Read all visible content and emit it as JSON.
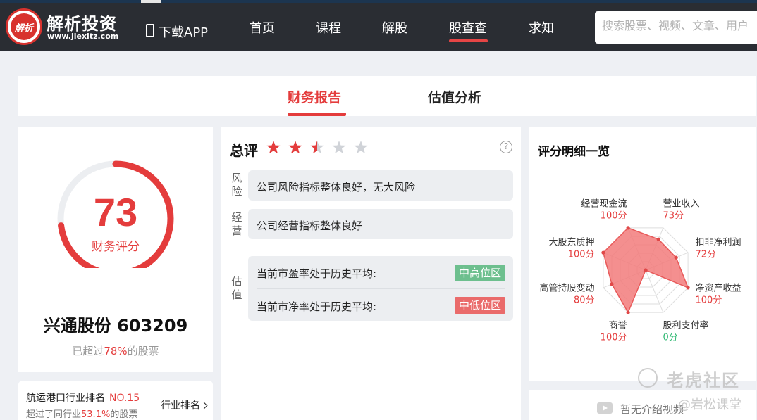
{
  "header": {
    "logo_badge": "解析",
    "logo_title": "解析投资",
    "logo_domain": "www.jiexitz.com",
    "app_download": "下载APP",
    "nav": [
      "首页",
      "课程",
      "解股",
      "股查查",
      "求知"
    ],
    "active_nav": "股查查",
    "search_placeholder": "搜索股票、视频、文章、用户"
  },
  "tabs": {
    "items": [
      "财务报告",
      "估值分析"
    ],
    "active": "财务报告"
  },
  "score": {
    "value": "73",
    "value_fraction": 0.73,
    "label": "财务评分",
    "stock": "兴通股份 603209",
    "beat_prefix": "已超过",
    "beat_pct": "78%",
    "beat_suffix": "的股票"
  },
  "rank": {
    "industry": "航运港口行业排名",
    "rank": "NO.15",
    "beat_prefix": "超过了同行业",
    "beat_pct": "53.1%",
    "beat_suffix": "的股票",
    "link": "行业排名"
  },
  "overall": {
    "title": "总评",
    "stars": 2.5,
    "stars_max": 5,
    "help": "?",
    "risk_label": "风险",
    "risk_text": "公司风险指标整体良好，无大风险",
    "ops_label": "经营",
    "ops_text": "公司经营指标整体良好",
    "valuation_label": "估值",
    "pe_text": "当前市盈率处于历史平均:",
    "pe_badge": "中高位区",
    "pb_text": "当前市净率处于历史平均:",
    "pb_badge": "中低位区"
  },
  "radar": {
    "title": "评分明细一览",
    "items": [
      {
        "name": "营业收入",
        "score": "73分",
        "value": 73
      },
      {
        "name": "扣非净利润",
        "score": "72分",
        "value": 72
      },
      {
        "name": "净资产收益",
        "score": "100分",
        "value": 100
      },
      {
        "name": "股利支付率",
        "score": "0分",
        "value": 0
      },
      {
        "name": "商誉",
        "score": "100分",
        "value": 100
      },
      {
        "name": "高管持股变动",
        "score": "80分",
        "value": 80
      },
      {
        "name": "大股东质押",
        "score": "100分",
        "value": 100
      },
      {
        "name": "经营现金流",
        "score": "100分",
        "value": 100
      }
    ]
  },
  "video": {
    "text": "暂无介绍视频"
  },
  "watermark": {
    "main": "老虎社区",
    "sub": "@岩松课堂"
  },
  "colors": {
    "accent": "#e43c3c",
    "badge_green": "#6dbf8e",
    "badge_red": "#ea6b6b",
    "radar_fill": "#f27b7b",
    "zero_green": "#2eb872"
  }
}
